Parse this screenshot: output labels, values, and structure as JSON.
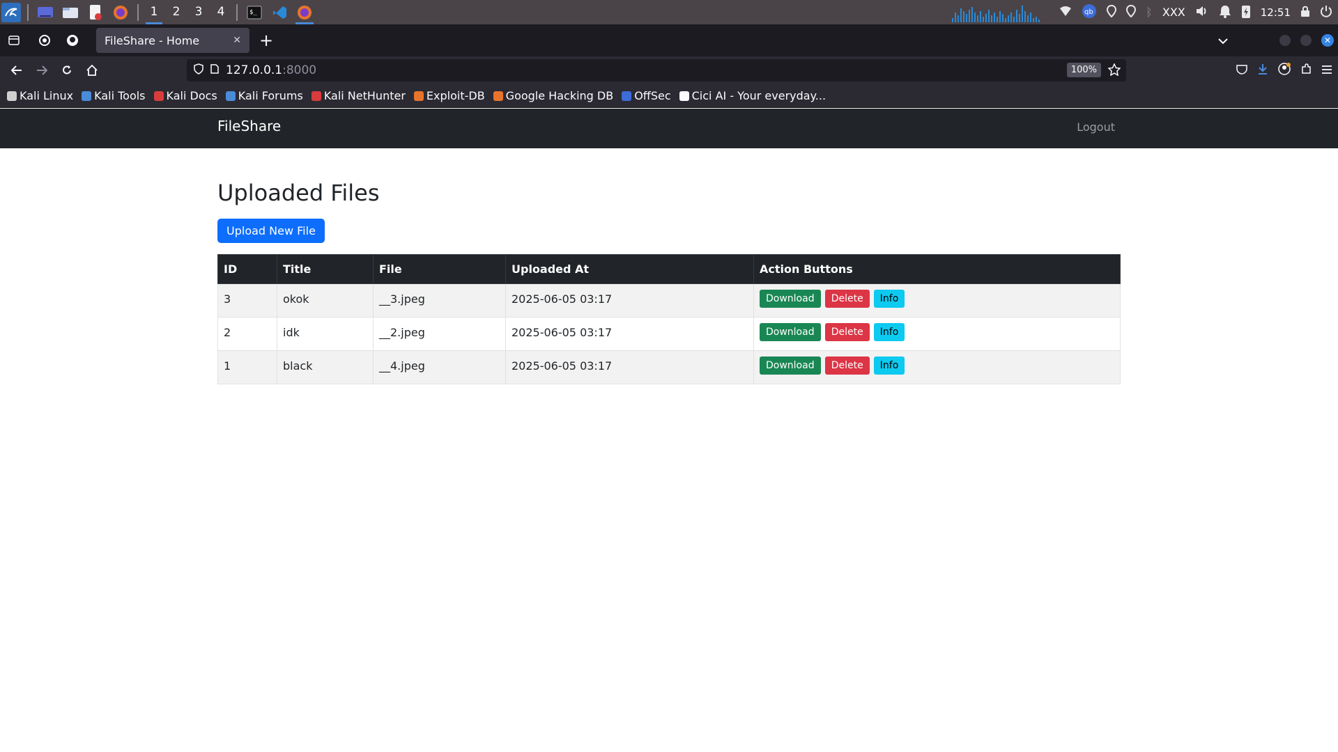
{
  "taskbar": {
    "apps": [
      "kali-menu-icon",
      "desktop-icon",
      "file-manager-icon",
      "text-editor-icon",
      "firefox-icon"
    ],
    "workspaces": [
      "1",
      "2",
      "3",
      "4"
    ],
    "pinned": [
      "terminal-icon",
      "vscode-icon",
      "firefox-icon"
    ],
    "status_text": "XXX",
    "clock": "12:51"
  },
  "browser": {
    "tab_title": "FileShare - Home",
    "url_host": "127.0.0.1",
    "url_port": ":8000",
    "zoom": "100%"
  },
  "bookmarks": [
    {
      "label": "Kali Linux",
      "color": "#cfcfcf"
    },
    {
      "label": "Kali Tools",
      "color": "#4a8bd8"
    },
    {
      "label": "Kali Docs",
      "color": "#d83c3c"
    },
    {
      "label": "Kali Forums",
      "color": "#4a8bd8"
    },
    {
      "label": "Kali NetHunter",
      "color": "#d83c3c"
    },
    {
      "label": "Exploit-DB",
      "color": "#e8742c"
    },
    {
      "label": "Google Hacking DB",
      "color": "#e8742c"
    },
    {
      "label": "OffSec",
      "color": "#3c6cd8"
    },
    {
      "label": "Cici AI - Your everyday...",
      "color": "#fbfbfe"
    }
  ],
  "site": {
    "brand": "FileShare",
    "logout": "Logout",
    "title": "Uploaded Files",
    "upload_button": "Upload New File"
  },
  "table": {
    "headers": [
      "ID",
      "Title",
      "File",
      "Uploaded At",
      "Action Buttons"
    ],
    "rows": [
      {
        "id": "3",
        "title": "okok",
        "file": "__3.jpeg",
        "uploaded_at": "2025-06-05 03:17"
      },
      {
        "id": "2",
        "title": "idk",
        "file": "__2.jpeg",
        "uploaded_at": "2025-06-05 03:17"
      },
      {
        "id": "1",
        "title": "black",
        "file": "__4.jpeg",
        "uploaded_at": "2025-06-05 03:17"
      }
    ],
    "actions": {
      "download": "Download",
      "delete": "Delete",
      "info": "Info"
    }
  },
  "colors": {
    "primary": "#0d6efd",
    "success": "#198754",
    "danger": "#dc3545",
    "info": "#0dcaf0",
    "navbar": "#212529"
  }
}
